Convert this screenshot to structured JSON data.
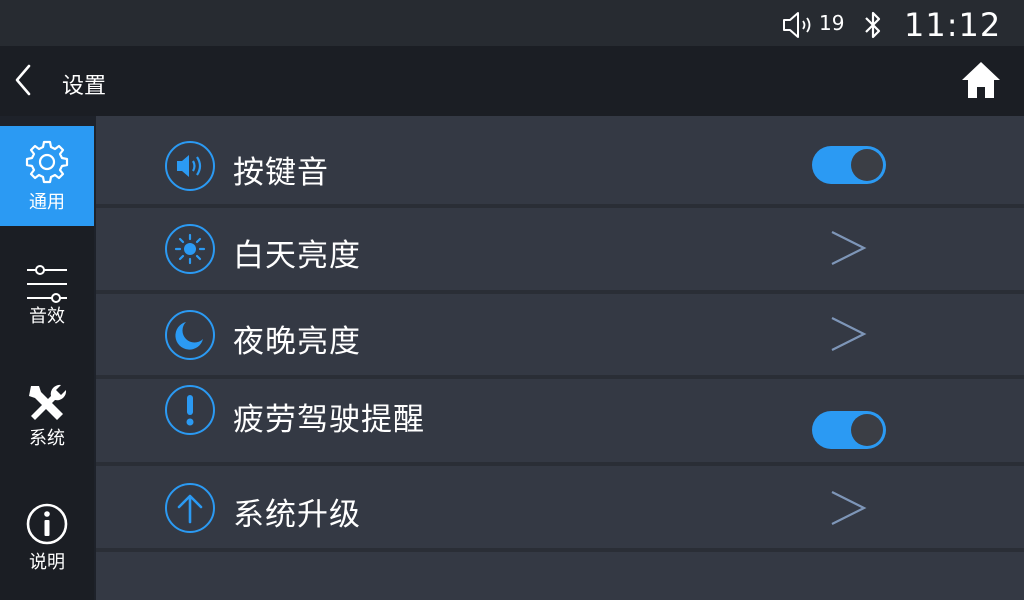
{
  "status_bar": {
    "volume_icon": "speaker-icon",
    "volume_level": "19",
    "bluetooth_icon": "bluetooth-icon",
    "time": "11:12"
  },
  "header": {
    "back_icon": "chevron-left-icon",
    "title": "设置",
    "home_icon": "home-icon"
  },
  "sidebar": {
    "items": [
      {
        "label": "通用",
        "icon": "gear-icon",
        "active": true
      },
      {
        "label": "音效",
        "icon": "sliders-icon",
        "active": false
      },
      {
        "label": "系统",
        "icon": "tools-icon",
        "active": false
      },
      {
        "label": "说明",
        "icon": "info-icon",
        "active": false
      }
    ]
  },
  "settings": {
    "rows": [
      {
        "label": "按键音",
        "icon": "speaker-icon",
        "control": "toggle",
        "value": "on"
      },
      {
        "label": "白天亮度",
        "icon": "sun-icon",
        "control": "chevron"
      },
      {
        "label": "夜晚亮度",
        "icon": "moon-icon",
        "control": "chevron"
      },
      {
        "label": "疲劳驾驶提醒",
        "icon": "exclamation-icon",
        "control": "toggle",
        "value": "on"
      },
      {
        "label": "系统升级",
        "icon": "arrow-up-icon",
        "control": "chevron"
      }
    ]
  },
  "colors": {
    "accent": "#2b9af3",
    "panel": "#343944",
    "background": "#1e222a",
    "chevron": "#7e96b8"
  }
}
